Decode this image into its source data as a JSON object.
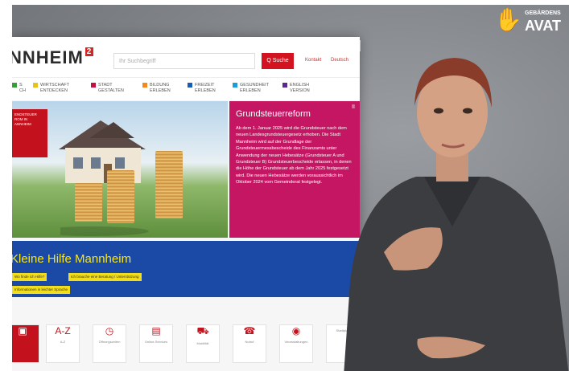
{
  "header": {
    "logo": "NNHEIM",
    "logo_sup": "2",
    "search_placeholder": "Ihr Suchbegriff",
    "search_button": "Q Suche",
    "link_1": "Kontakt",
    "link_2": "Deutsch"
  },
  "nav": [
    {
      "label": "S\nCH",
      "color": "#3a9d3a"
    },
    {
      "label": "WIRTSCHAFT\nENTDECKEN",
      "color": "#e8c21b"
    },
    {
      "label": "STADT\nGESTALTEN",
      "color": "#c31241"
    },
    {
      "label": "BILDUNG\nERLEBEN",
      "color": "#f08a1a"
    },
    {
      "label": "FREIZEIT\nERLEBEN",
      "color": "#1b5bb8"
    },
    {
      "label": "GESUNDHEIT\nERLEBEN",
      "color": "#1a9ed8"
    },
    {
      "label": "ENGLISH\nVERSION",
      "color": "#5a2a8a"
    }
  ],
  "hero": {
    "promo": "ENDSTEUER\nROM IN\nANNHEIM"
  },
  "info": {
    "title": "Grundsteuerreform",
    "text": "Ab dem 1. Januar 2025 wird die Grundsteuer nach dem neuen Landesgrundsteuergesetz erhoben. Die Stadt Mannheim wird auf der Grundlage der Grundsteuermessbescheide des Finanzamts unter Anwendung der neuen Hebesätze (Grundsteuer A und Grundsteuer B) Grundsteuerbescheide erlassen, in denen die Höhe der Grundsteuer ab dem Jahr 2025 festgesetzt wird. Die neuen Hebesätze werden voraussichtlich im Oktober 2024 vom Gemeinderat festgelegt.",
    "pause": "II"
  },
  "band": {
    "title": "Kleine Hilfe Mannheim",
    "links": [
      "Wo finde ich Hilfe?",
      "Ich brauche eine Beratung / Unterstützung",
      "Informationen in leichter Sprache"
    ]
  },
  "icons": [
    {
      "glyph": "▣",
      "label": ""
    },
    {
      "glyph": "A-Z",
      "label": "A-Z"
    },
    {
      "glyph": "◷",
      "label": "Öffnungszeiten"
    },
    {
      "glyph": "▤",
      "label": "Online-Services"
    },
    {
      "glyph": "⛟",
      "label": "Mobilität"
    },
    {
      "glyph": "☎",
      "label": "Notruf"
    },
    {
      "glyph": "◉",
      "label": "Veranstaltungen"
    },
    {
      "glyph": "",
      "label": "Stadtplan"
    }
  ],
  "brand": {
    "small": "GEBÄRDENS",
    "big": "AVAT"
  }
}
